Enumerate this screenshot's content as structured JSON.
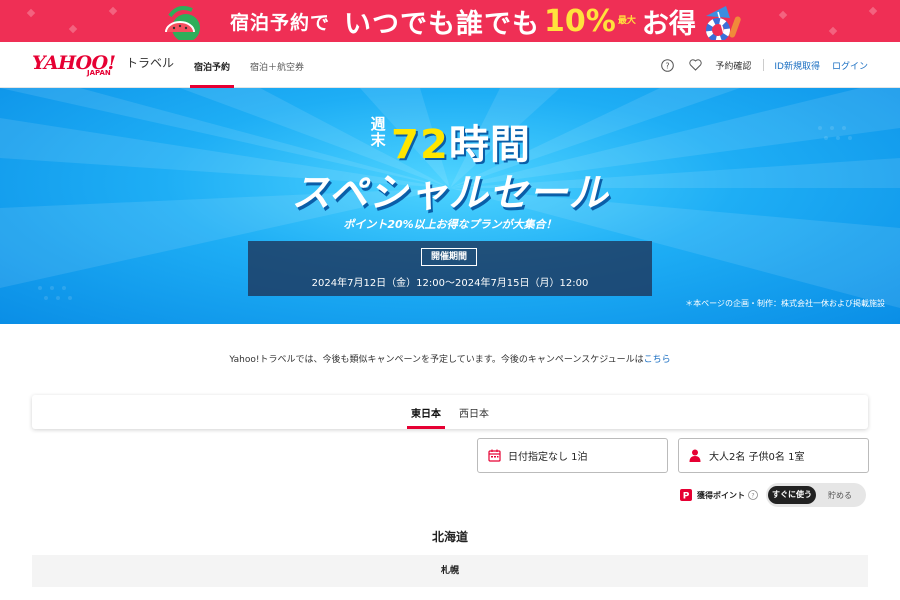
{
  "promo": {
    "text_a": "宿泊予約で",
    "text_b": "いつでも誰でも",
    "text_pct": "10%",
    "text_max_1": "最大",
    "text_e": "お得"
  },
  "header": {
    "logo_main": "YAHOO!",
    "logo_sub": "JAPAN",
    "logo_service": "トラベル",
    "tabs": [
      {
        "label": "宿泊予約",
        "active": true
      },
      {
        "label": "宿泊＋航空券",
        "active": false
      }
    ],
    "help_icon": "help-icon",
    "favorite_icon": "heart-icon",
    "reservation_link": "予約確認",
    "signup_link": "ID新規取得",
    "login_link": "ログイン"
  },
  "hero": {
    "title_prefix": "週末",
    "title_number": "72",
    "title_suffix": "時間",
    "title_main": "スペシャルセール",
    "subtitle": "ポイント20%以上お得なプランが大集合！",
    "period_label": "開催期間",
    "period_dates": "2024年7月12日（金）12:00〜2024年7月15日（月）12:00",
    "note": "＊本ページの企画・制作：株式会社一休および掲載施設"
  },
  "info": {
    "text": "Yahoo!トラベルでは、今後も類似キャンペーンを予定しています。今後のキャンペーンスケジュールは",
    "link": "こちら"
  },
  "regions": {
    "tabs": [
      {
        "label": "東日本",
        "active": true
      },
      {
        "label": "西日本",
        "active": false
      }
    ]
  },
  "search": {
    "date_field": "日付指定なし 1泊",
    "guests_field": "大人2名 子供0名 1室"
  },
  "points": {
    "label": "獲得ポイント",
    "toggle_on": "すぐに使う",
    "toggle_off": "貯める"
  },
  "area": {
    "title": "北海道",
    "first_row": "札幌"
  },
  "colors": {
    "brand_red": "#e60033",
    "promo_bg": "#ef2f55",
    "link_blue": "#1b6fc2",
    "hero_blue": "#1eaef5"
  }
}
